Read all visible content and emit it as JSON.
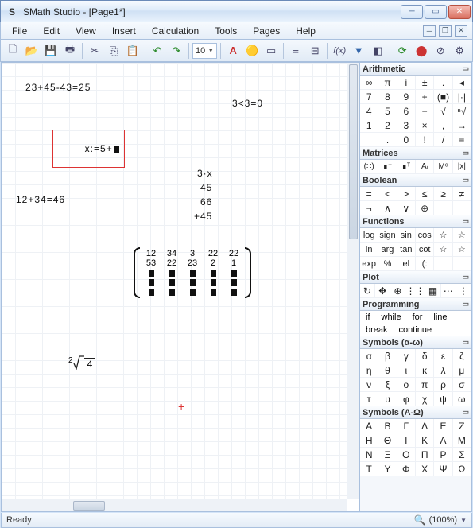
{
  "window": {
    "title": "SMath Studio - [Page1*]"
  },
  "menus": [
    "File",
    "Edit",
    "View",
    "Insert",
    "Calculation",
    "Tools",
    "Pages",
    "Help"
  ],
  "toolbar": {
    "font_size": "10",
    "fx_label": "f(x)"
  },
  "expressions": {
    "e1": "23+45-43=25",
    "e2": "3<3=0",
    "e3": "x:=5+",
    "e4": "12+34=46",
    "stack": [
      "3·x",
      "45",
      "66",
      "+45"
    ]
  },
  "matrix": {
    "rows": [
      [
        "12",
        "34",
        "3",
        "22",
        "22"
      ],
      [
        "53",
        "22",
        "23",
        "2",
        "1"
      ]
    ],
    "placeholder_rows": 3
  },
  "sqrt": {
    "degree": "2",
    "arg": "4"
  },
  "panels": {
    "arithmetic": {
      "title": "Arithmetic",
      "grid": [
        [
          "∞",
          "π",
          "i",
          "±",
          ".",
          "◂"
        ],
        [
          "7",
          "8",
          "9",
          "+",
          "(■)",
          "|·|"
        ],
        [
          "4",
          "5",
          "6",
          "−",
          "√",
          "ⁿ√"
        ],
        [
          "1",
          "2",
          "3",
          "×",
          ",",
          "→"
        ],
        [
          "",
          ".",
          "0",
          "!",
          "/",
          "≡"
        ]
      ]
    },
    "matrices": {
      "title": "Matrices",
      "grid": [
        [
          "(∷)",
          "∎⁻",
          "∎ᵀ",
          "Aᵢ",
          "Mᶜ",
          "|x|"
        ]
      ]
    },
    "boolean": {
      "title": "Boolean",
      "grid": [
        [
          "=",
          "<",
          ">",
          "≤",
          "≥",
          "≠"
        ],
        [
          "¬",
          "∧",
          "∨",
          "⊕",
          "",
          ""
        ]
      ]
    },
    "functions": {
      "title": "Functions",
      "grid": [
        [
          "log",
          "sign",
          "sin",
          "cos",
          "☆",
          "☆"
        ],
        [
          "ln",
          "arg",
          "tan",
          "cot",
          "☆",
          "☆"
        ],
        [
          "exp",
          "%",
          "el",
          "(:",
          "",
          ""
        ]
      ]
    },
    "plot": {
      "title": "Plot",
      "grid": [
        [
          "↻",
          "✥",
          "⊕",
          "⋮⋮",
          "▦",
          "⋯",
          "⋮"
        ]
      ]
    },
    "programming": {
      "title": "Programming",
      "items": [
        "if",
        "while",
        "for",
        "line",
        "break",
        "continue"
      ]
    },
    "greek_lower": {
      "title": "Symbols (α-ω)",
      "grid": [
        [
          "α",
          "β",
          "γ",
          "δ",
          "ε",
          "ζ"
        ],
        [
          "η",
          "θ",
          "ι",
          "κ",
          "λ",
          "μ"
        ],
        [
          "ν",
          "ξ",
          "ο",
          "π",
          "ρ",
          "σ"
        ],
        [
          "τ",
          "υ",
          "φ",
          "χ",
          "ψ",
          "ω"
        ]
      ]
    },
    "greek_upper": {
      "title": "Symbols (Α-Ω)",
      "grid": [
        [
          "Α",
          "Β",
          "Γ",
          "Δ",
          "Ε",
          "Ζ"
        ],
        [
          "Η",
          "Θ",
          "Ι",
          "Κ",
          "Λ",
          "Μ"
        ],
        [
          "Ν",
          "Ξ",
          "Ο",
          "Π",
          "Ρ",
          "Σ"
        ],
        [
          "Τ",
          "Υ",
          "Φ",
          "Χ",
          "Ψ",
          "Ω"
        ]
      ]
    }
  },
  "status": {
    "text": "Ready",
    "zoom": "(100%)"
  }
}
